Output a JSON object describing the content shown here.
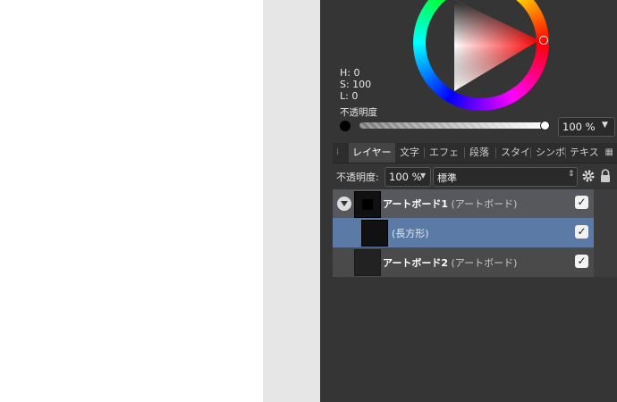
{
  "color": {
    "h_label": "H: 0",
    "s_label": "S: 100",
    "l_label": "L: 0",
    "opacity_label": "不透明度",
    "opacity_value": "100 %"
  },
  "tabs": [
    "レイヤー",
    "文字",
    "エフェ",
    "段落",
    "スタイ",
    "シンボ",
    "テキス"
  ],
  "active_tab": "レイヤー",
  "layer_toolbar": {
    "opacity_label": "不透明度:",
    "opacity_value": "100 %",
    "blend_mode": "標準"
  },
  "layers": [
    {
      "name": "アートボード1",
      "type": "(アートボード)",
      "selected": false,
      "expanded": true,
      "visible": true
    },
    {
      "name": "",
      "type": "(長方形)",
      "selected": true,
      "visible": true
    },
    {
      "name": "アートボード2",
      "type": "(アートボード)",
      "selected": false,
      "visible": true
    }
  ],
  "colors": {
    "panel_bg": "#353535",
    "selection": "#5b7ba6",
    "row_bg": "#4a4a4a",
    "artboard1_row": "#56585c"
  }
}
